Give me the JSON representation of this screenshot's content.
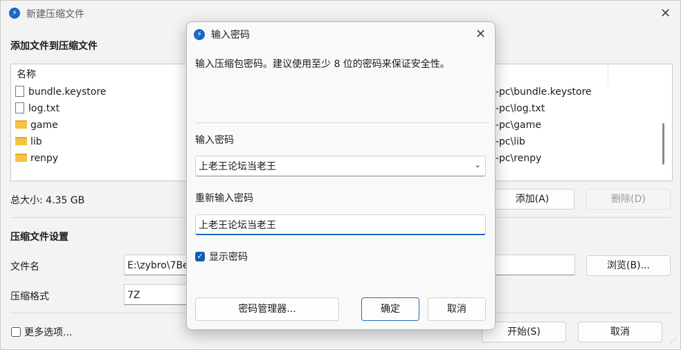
{
  "main": {
    "title": "新建压缩文件",
    "add_files_heading": "添加文件到压缩文件",
    "file_list_header": "名称",
    "files": [
      {
        "name": "bundle.keystore",
        "type": "file",
        "path": "0-pc\\bundle.keystore"
      },
      {
        "name": "log.txt",
        "type": "file",
        "path": "0-pc\\log.txt"
      },
      {
        "name": "game",
        "type": "folder",
        "path": "0-pc\\game"
      },
      {
        "name": "lib",
        "type": "folder",
        "path": "0-pc\\lib"
      },
      {
        "name": "renpy",
        "type": "folder",
        "path": "0-pc\\renpy"
      }
    ],
    "total_size": "总大小: 4.35 GB",
    "add_button": "添加(A)",
    "delete_button": "删除(D)",
    "settings_heading": "压缩文件设置",
    "filename_label": "文件名",
    "filename_value": "E:\\zybro\\7Be",
    "format_label": "压缩格式",
    "format_value": "7Z",
    "browse_button": "浏览(B)...",
    "more_options": "更多选项...",
    "start_button": "开始(S)",
    "cancel_button": "取消"
  },
  "dialog": {
    "title": "输入密码",
    "description": "输入压缩包密码。建议使用至少 8 位的密码来保证安全性。",
    "password_label": "输入密码",
    "password_value": "上老王论坛当老王",
    "repeat_label": "重新输入密码",
    "repeat_value": "上老王论坛当老王",
    "show_password_label": "显示密码",
    "show_password_checked": true,
    "manager_button": "密码管理器...",
    "ok_button": "确定",
    "cancel_button": "取消"
  },
  "colors": {
    "accent": "#0f5fb5",
    "folder": "#f6c343"
  }
}
